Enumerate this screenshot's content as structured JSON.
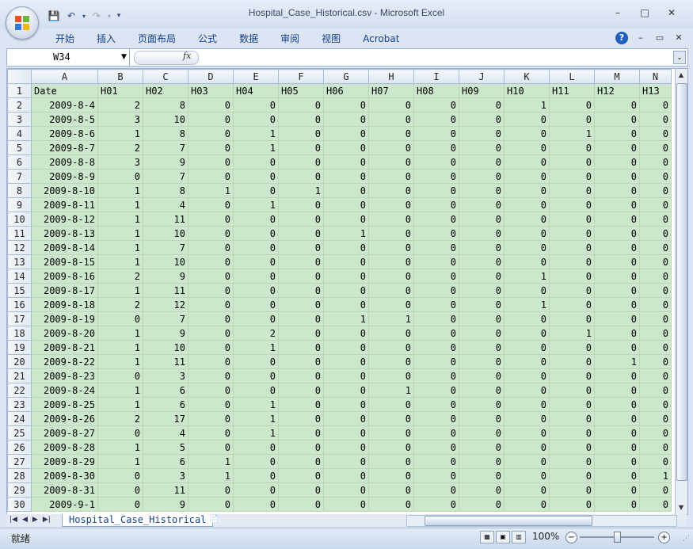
{
  "window": {
    "title": "Hospital_Case_Historical.csv - Microsoft Excel",
    "minimize": "–",
    "maximize": "□",
    "close": "✕"
  },
  "ribbon": {
    "tabs": [
      "开始",
      "插入",
      "页面布局",
      "公式",
      "数据",
      "审阅",
      "视图",
      "Acrobat"
    ],
    "help": "?",
    "min": "–",
    "restore": "▭",
    "close": "✕"
  },
  "formula_bar": {
    "name_box": "W34",
    "fx": "fx",
    "value": ""
  },
  "sheet": {
    "columns": [
      "A",
      "B",
      "C",
      "D",
      "E",
      "F",
      "G",
      "H",
      "I",
      "J",
      "K",
      "L",
      "M",
      "N"
    ],
    "header_row": [
      "Date",
      "H01",
      "H02",
      "H03",
      "H04",
      "H05",
      "H06",
      "H07",
      "H08",
      "H09",
      "H10",
      "H11",
      "H12",
      "H13"
    ],
    "rows": [
      [
        "2009-8-4",
        "2",
        "8",
        "0",
        "0",
        "0",
        "0",
        "0",
        "0",
        "0",
        "1",
        "0",
        "0",
        "0"
      ],
      [
        "2009-8-5",
        "3",
        "10",
        "0",
        "0",
        "0",
        "0",
        "0",
        "0",
        "0",
        "0",
        "0",
        "0",
        "0"
      ],
      [
        "2009-8-6",
        "1",
        "8",
        "0",
        "1",
        "0",
        "0",
        "0",
        "0",
        "0",
        "0",
        "1",
        "0",
        "0"
      ],
      [
        "2009-8-7",
        "2",
        "7",
        "0",
        "1",
        "0",
        "0",
        "0",
        "0",
        "0",
        "0",
        "0",
        "0",
        "0"
      ],
      [
        "2009-8-8",
        "3",
        "9",
        "0",
        "0",
        "0",
        "0",
        "0",
        "0",
        "0",
        "0",
        "0",
        "0",
        "0"
      ],
      [
        "2009-8-9",
        "0",
        "7",
        "0",
        "0",
        "0",
        "0",
        "0",
        "0",
        "0",
        "0",
        "0",
        "0",
        "0"
      ],
      [
        "2009-8-10",
        "1",
        "8",
        "1",
        "0",
        "1",
        "0",
        "0",
        "0",
        "0",
        "0",
        "0",
        "0",
        "0"
      ],
      [
        "2009-8-11",
        "1",
        "4",
        "0",
        "1",
        "0",
        "0",
        "0",
        "0",
        "0",
        "0",
        "0",
        "0",
        "0"
      ],
      [
        "2009-8-12",
        "1",
        "11",
        "0",
        "0",
        "0",
        "0",
        "0",
        "0",
        "0",
        "0",
        "0",
        "0",
        "0"
      ],
      [
        "2009-8-13",
        "1",
        "10",
        "0",
        "0",
        "0",
        "1",
        "0",
        "0",
        "0",
        "0",
        "0",
        "0",
        "0"
      ],
      [
        "2009-8-14",
        "1",
        "7",
        "0",
        "0",
        "0",
        "0",
        "0",
        "0",
        "0",
        "0",
        "0",
        "0",
        "0"
      ],
      [
        "2009-8-15",
        "1",
        "10",
        "0",
        "0",
        "0",
        "0",
        "0",
        "0",
        "0",
        "0",
        "0",
        "0",
        "0"
      ],
      [
        "2009-8-16",
        "2",
        "9",
        "0",
        "0",
        "0",
        "0",
        "0",
        "0",
        "0",
        "1",
        "0",
        "0",
        "0"
      ],
      [
        "2009-8-17",
        "1",
        "11",
        "0",
        "0",
        "0",
        "0",
        "0",
        "0",
        "0",
        "0",
        "0",
        "0",
        "0"
      ],
      [
        "2009-8-18",
        "2",
        "12",
        "0",
        "0",
        "0",
        "0",
        "0",
        "0",
        "0",
        "1",
        "0",
        "0",
        "0"
      ],
      [
        "2009-8-19",
        "0",
        "7",
        "0",
        "0",
        "0",
        "1",
        "1",
        "0",
        "0",
        "0",
        "0",
        "0",
        "0"
      ],
      [
        "2009-8-20",
        "1",
        "9",
        "0",
        "2",
        "0",
        "0",
        "0",
        "0",
        "0",
        "0",
        "1",
        "0",
        "0"
      ],
      [
        "2009-8-21",
        "1",
        "10",
        "0",
        "1",
        "0",
        "0",
        "0",
        "0",
        "0",
        "0",
        "0",
        "0",
        "0"
      ],
      [
        "2009-8-22",
        "1",
        "11",
        "0",
        "0",
        "0",
        "0",
        "0",
        "0",
        "0",
        "0",
        "0",
        "1",
        "0"
      ],
      [
        "2009-8-23",
        "0",
        "3",
        "0",
        "0",
        "0",
        "0",
        "0",
        "0",
        "0",
        "0",
        "0",
        "0",
        "0"
      ],
      [
        "2009-8-24",
        "1",
        "6",
        "0",
        "0",
        "0",
        "0",
        "1",
        "0",
        "0",
        "0",
        "0",
        "0",
        "0"
      ],
      [
        "2009-8-25",
        "1",
        "6",
        "0",
        "1",
        "0",
        "0",
        "0",
        "0",
        "0",
        "0",
        "0",
        "0",
        "0"
      ],
      [
        "2009-8-26",
        "2",
        "17",
        "0",
        "1",
        "0",
        "0",
        "0",
        "0",
        "0",
        "0",
        "0",
        "0",
        "0"
      ],
      [
        "2009-8-27",
        "0",
        "4",
        "0",
        "1",
        "0",
        "0",
        "0",
        "0",
        "0",
        "0",
        "0",
        "0",
        "0"
      ],
      [
        "2009-8-28",
        "1",
        "5",
        "0",
        "0",
        "0",
        "0",
        "0",
        "0",
        "0",
        "0",
        "0",
        "0",
        "0"
      ],
      [
        "2009-8-29",
        "1",
        "6",
        "1",
        "0",
        "0",
        "0",
        "0",
        "0",
        "0",
        "0",
        "0",
        "0",
        "0"
      ],
      [
        "2009-8-30",
        "0",
        "3",
        "1",
        "0",
        "0",
        "0",
        "0",
        "0",
        "0",
        "0",
        "0",
        "0",
        "1"
      ],
      [
        "2009-8-31",
        "0",
        "11",
        "0",
        "0",
        "0",
        "0",
        "0",
        "0",
        "0",
        "0",
        "0",
        "0",
        "0"
      ],
      [
        "2009-9-1",
        "0",
        "9",
        "0",
        "0",
        "0",
        "0",
        "0",
        "0",
        "0",
        "0",
        "0",
        "0",
        "0"
      ]
    ]
  },
  "sheet_tabs": {
    "active": "Hospital_Case_Historical"
  },
  "status": {
    "mode": "就绪",
    "zoom": "100%"
  },
  "colors": {
    "cell_fill": "#cce8cc",
    "ribbon_text": "#15428b"
  }
}
